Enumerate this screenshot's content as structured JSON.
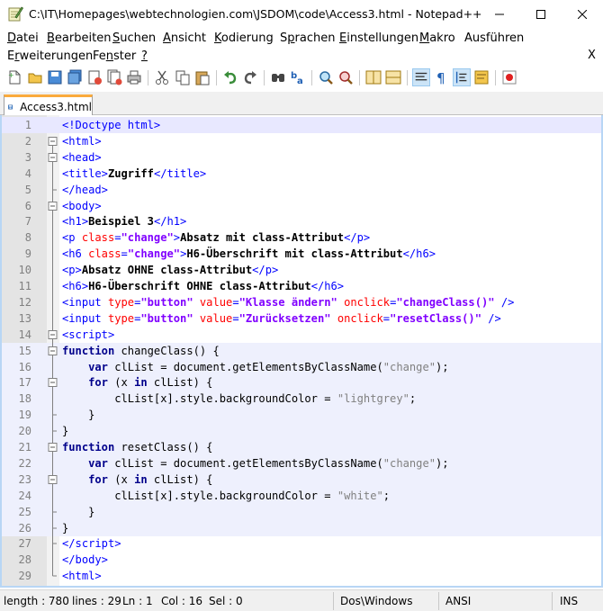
{
  "window": {
    "title": "C:\\IT\\Homepages\\webtechnologien.com\\JSDOM\\code\\Access3.html - Notepad++"
  },
  "menu": {
    "row1": [
      {
        "underline": "D",
        "rest": "atei"
      },
      {
        "underline": "B",
        "rest": "earbeiten"
      },
      {
        "underline": "S",
        "rest": "uchen"
      },
      {
        "underline": "A",
        "rest": "nsicht"
      },
      {
        "underline": "K",
        "rest": "odierung"
      },
      {
        "underline": "S",
        "rest": "prachen",
        "pre": "S",
        "mode": "mid"
      },
      {
        "underline": "E",
        "rest": "instellungen"
      },
      {
        "underline": "M",
        "rest": "akro"
      },
      {
        "underline": "A",
        "rest": "usführen",
        "mode": "plain"
      }
    ],
    "row1_labels": [
      "Datei",
      "Bearbeiten",
      "Suchen",
      "Ansicht",
      "Kodierung",
      "Sprachen",
      "Einstellungen",
      "Makro",
      "Ausführen"
    ],
    "row2_labels": [
      "Erweiterungen",
      "Fenster",
      "?"
    ],
    "close_glyph": "X"
  },
  "toolbar": {
    "icons": [
      "new-file-icon",
      "open-file-icon",
      "save-icon",
      "save-all-icon",
      "close-icon",
      "close-all-icon",
      "print-icon",
      "cut-icon",
      "copy-icon",
      "paste-icon",
      "undo-icon",
      "redo-icon",
      "find-icon",
      "replace-icon",
      "zoom-in-icon",
      "zoom-out-icon",
      "sync-vertical-icon",
      "sync-horizontal-icon",
      "word-wrap-icon",
      "show-all-chars-icon",
      "indent-guide-icon",
      "doc-map-icon",
      "record-macro-icon"
    ]
  },
  "tabs": [
    {
      "label": "Access3.html",
      "active": true
    }
  ],
  "editor": {
    "lines": [
      {
        "n": "1",
        "html": "<span class=\"t-tag\">&lt;!Doctype html&gt;</span>"
      },
      {
        "n": "2",
        "html": "<span class=\"t-tag\">&lt;html&gt;</span>"
      },
      {
        "n": "3",
        "html": "<span class=\"t-tag\">&lt;head&gt;</span>"
      },
      {
        "n": "4",
        "html": "<span class=\"t-tag\">&lt;title&gt;</span><span class=\"t-text\">Zugriff</span><span class=\"t-tag\">&lt;/title&gt;</span>"
      },
      {
        "n": "5",
        "html": "<span class=\"t-tag\">&lt;/head&gt;</span>"
      },
      {
        "n": "6",
        "html": "<span class=\"t-tag\">&lt;body&gt;</span>"
      },
      {
        "n": "7",
        "html": "<span class=\"t-tag\">&lt;h1&gt;</span><span class=\"t-text\">Beispiel 3</span><span class=\"t-tag\">&lt;/h1&gt;</span>"
      },
      {
        "n": "8",
        "html": "<span class=\"t-tag\">&lt;p </span><span class=\"t-attr\">class</span><span class=\"t-tag\">=</span><span class=\"t-val\">\"change\"</span><span class=\"t-tag\">&gt;</span><span class=\"t-text\">Absatz mit class-Attribut</span><span class=\"t-tag\">&lt;/p&gt;</span>"
      },
      {
        "n": "9",
        "html": "<span class=\"t-tag\">&lt;h6 </span><span class=\"t-attr\">class</span><span class=\"t-tag\">=</span><span class=\"t-val\">\"change\"</span><span class=\"t-tag\">&gt;</span><span class=\"t-text\">H6-Überschrift mit class-Attribut</span><span class=\"t-tag\">&lt;/h6&gt;</span>"
      },
      {
        "n": "10",
        "html": "<span class=\"t-tag\">&lt;p&gt;</span><span class=\"t-text\">Absatz OHNE class-Attribut</span><span class=\"t-tag\">&lt;/p&gt;</span>"
      },
      {
        "n": "11",
        "html": "<span class=\"t-tag\">&lt;h6&gt;</span><span class=\"t-text\">H6-Überschrift OHNE class-Attribut</span><span class=\"t-tag\">&lt;/h6&gt;</span>"
      },
      {
        "n": "12",
        "html": "<span class=\"t-tag\">&lt;input </span><span class=\"t-attr\">type</span><span class=\"t-tag\">=</span><span class=\"t-val\">\"button\"</span><span class=\"t-tag\"> </span><span class=\"t-attr\">value</span><span class=\"t-tag\">=</span><span class=\"t-val\">\"Klasse ändern\"</span><span class=\"t-tag\"> </span><span class=\"t-attr\">onclick</span><span class=\"t-tag\">=</span><span class=\"t-val\">\"changeClass()\"</span><span class=\"t-tag\"> /&gt;</span>"
      },
      {
        "n": "13",
        "html": "<span class=\"t-tag\">&lt;input </span><span class=\"t-attr\">type</span><span class=\"t-tag\">=</span><span class=\"t-val\">\"button\"</span><span class=\"t-tag\"> </span><span class=\"t-attr\">value</span><span class=\"t-tag\">=</span><span class=\"t-val\">\"Zurücksetzen\"</span><span class=\"t-tag\"> </span><span class=\"t-attr\">onclick</span><span class=\"t-tag\">=</span><span class=\"t-val\">\"resetClass()\"</span><span class=\"t-tag\"> /&gt;</span>"
      },
      {
        "n": "14",
        "html": "<span class=\"t-tag\">&lt;script&gt;</span>"
      },
      {
        "n": "15",
        "html": "<span class=\"t-kw\">function</span><span class=\"t-plain\"> changeClass() {</span>"
      },
      {
        "n": "16",
        "html": "<span class=\"t-plain\">    </span><span class=\"t-kw\">var</span><span class=\"t-plain\"> clList = document.getElementsByClassName(</span><span class=\"t-str\">\"change\"</span><span class=\"t-plain\">);</span>"
      },
      {
        "n": "17",
        "html": "<span class=\"t-plain\">    </span><span class=\"t-kw\">for</span><span class=\"t-plain\"> (x </span><span class=\"t-kw\">in</span><span class=\"t-plain\"> clList) {</span>"
      },
      {
        "n": "18",
        "html": "<span class=\"t-plain\">        clList[x].style.backgroundColor = </span><span class=\"t-str\">\"lightgrey\"</span><span class=\"t-plain\">;</span>"
      },
      {
        "n": "19",
        "html": "<span class=\"t-plain\">    }</span>"
      },
      {
        "n": "20",
        "html": "<span class=\"t-plain\">}</span>"
      },
      {
        "n": "21",
        "html": "<span class=\"t-kw\">function</span><span class=\"t-plain\"> resetClass() {</span>"
      },
      {
        "n": "22",
        "html": "<span class=\"t-plain\">    </span><span class=\"t-kw\">var</span><span class=\"t-plain\"> clList = document.getElementsByClassName(</span><span class=\"t-str\">\"change\"</span><span class=\"t-plain\">);</span>"
      },
      {
        "n": "23",
        "html": "<span class=\"t-plain\">    </span><span class=\"t-kw\">for</span><span class=\"t-plain\"> (x </span><span class=\"t-kw\">in</span><span class=\"t-plain\"> clList) {</span>"
      },
      {
        "n": "24",
        "html": "<span class=\"t-plain\">        clList[x].style.backgroundColor = </span><span class=\"t-str\">\"white\"</span><span class=\"t-plain\">;</span>"
      },
      {
        "n": "25",
        "html": "<span class=\"t-plain\">    }</span>"
      },
      {
        "n": "26",
        "html": "<span class=\"t-plain\">}</span>"
      },
      {
        "n": "27",
        "html": "<span class=\"t-tag\">&lt;/script&gt;</span>"
      },
      {
        "n": "28",
        "html": "<span class=\"t-tag\">&lt;/body&gt;</span>"
      },
      {
        "n": "29",
        "html": "<span class=\"t-tag\">&lt;html&gt;</span>"
      }
    ],
    "fold_markers": [
      "",
      "box",
      "box",
      "line",
      "end",
      "box",
      "line",
      "line",
      "line",
      "line",
      "line",
      "line",
      "line",
      "box",
      "box",
      "line",
      "box",
      "line",
      "end",
      "end",
      "box",
      "line",
      "box",
      "line",
      "end",
      "end",
      "end",
      "line",
      "end"
    ],
    "current_line": 1,
    "highlighted_range": [
      15,
      26
    ]
  },
  "status": {
    "length": "length : 780",
    "lines": "lines : 29",
    "ln": "Ln : 1",
    "col": "Col : 16",
    "sel": "Sel : 0",
    "eol": "Dos\\Windows",
    "encoding": "ANSI",
    "mode": "INS"
  },
  "colors": {
    "tab_accent": "#faaa3c",
    "current_line": "#e8e8ff",
    "tag": "#0000ff",
    "attribute": "#ff0000",
    "attr_value": "#8000ff",
    "keyword": "#00008b"
  }
}
